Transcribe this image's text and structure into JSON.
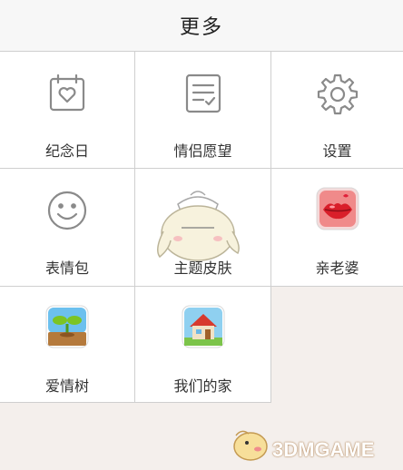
{
  "header": {
    "title": "更多"
  },
  "items": [
    {
      "label": "纪念日",
      "icon": "calendar-heart-icon"
    },
    {
      "label": "情侣愿望",
      "icon": "checklist-icon"
    },
    {
      "label": "设置",
      "icon": "gear-icon"
    },
    {
      "label": "表情包",
      "icon": "smiley-icon"
    },
    {
      "label": "主题皮肤",
      "icon": "theme-skin-icon"
    },
    {
      "label": "亲老婆",
      "icon": "kiss-lips-icon"
    },
    {
      "label": "爱情树",
      "icon": "love-tree-icon"
    },
    {
      "label": "我们的家",
      "icon": "house-icon"
    }
  ],
  "watermark": {
    "text": "3DMGAME"
  },
  "colors": {
    "background": "#f4efec",
    "cell": "#ffffff",
    "border": "#cfcfcf",
    "icon_gray": "#8a8a8a"
  }
}
